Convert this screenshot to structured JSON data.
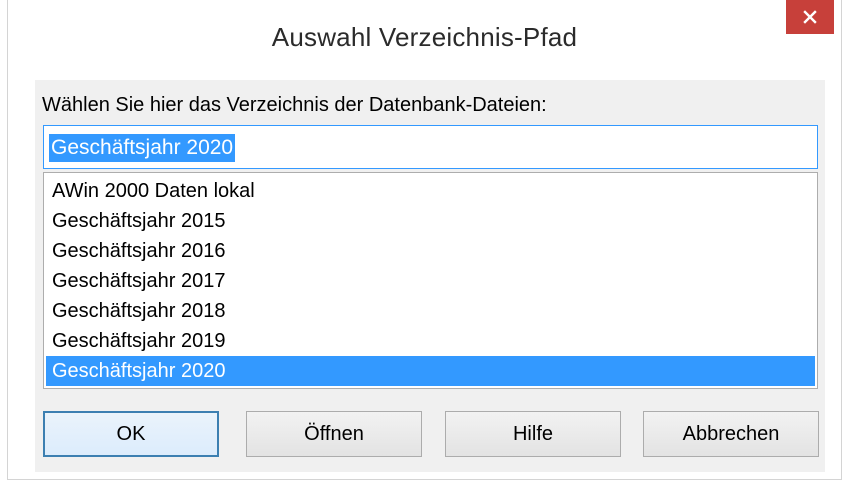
{
  "window": {
    "title": "Auswahl Verzeichnis-Pfad",
    "close_icon": "close-icon",
    "close_color": "#c7403a"
  },
  "prompt": "Wählen Sie hier das Verzeichnis der Datenbank-Dateien:",
  "path_input": {
    "value": "Geschäftsjahr 2020"
  },
  "directory_list": {
    "items": [
      "AWin 2000 Daten lokal",
      "Geschäftsjahr 2015",
      "Geschäftsjahr 2016",
      "Geschäftsjahr 2017",
      "Geschäftsjahr 2018",
      "Geschäftsjahr 2019",
      "Geschäftsjahr 2020"
    ],
    "selected": "Geschäftsjahr 2020",
    "selection_color": "#3399ff"
  },
  "buttons": {
    "ok": "OK",
    "open": "Öffnen",
    "help": "Hilfe",
    "cancel": "Abbrechen"
  }
}
